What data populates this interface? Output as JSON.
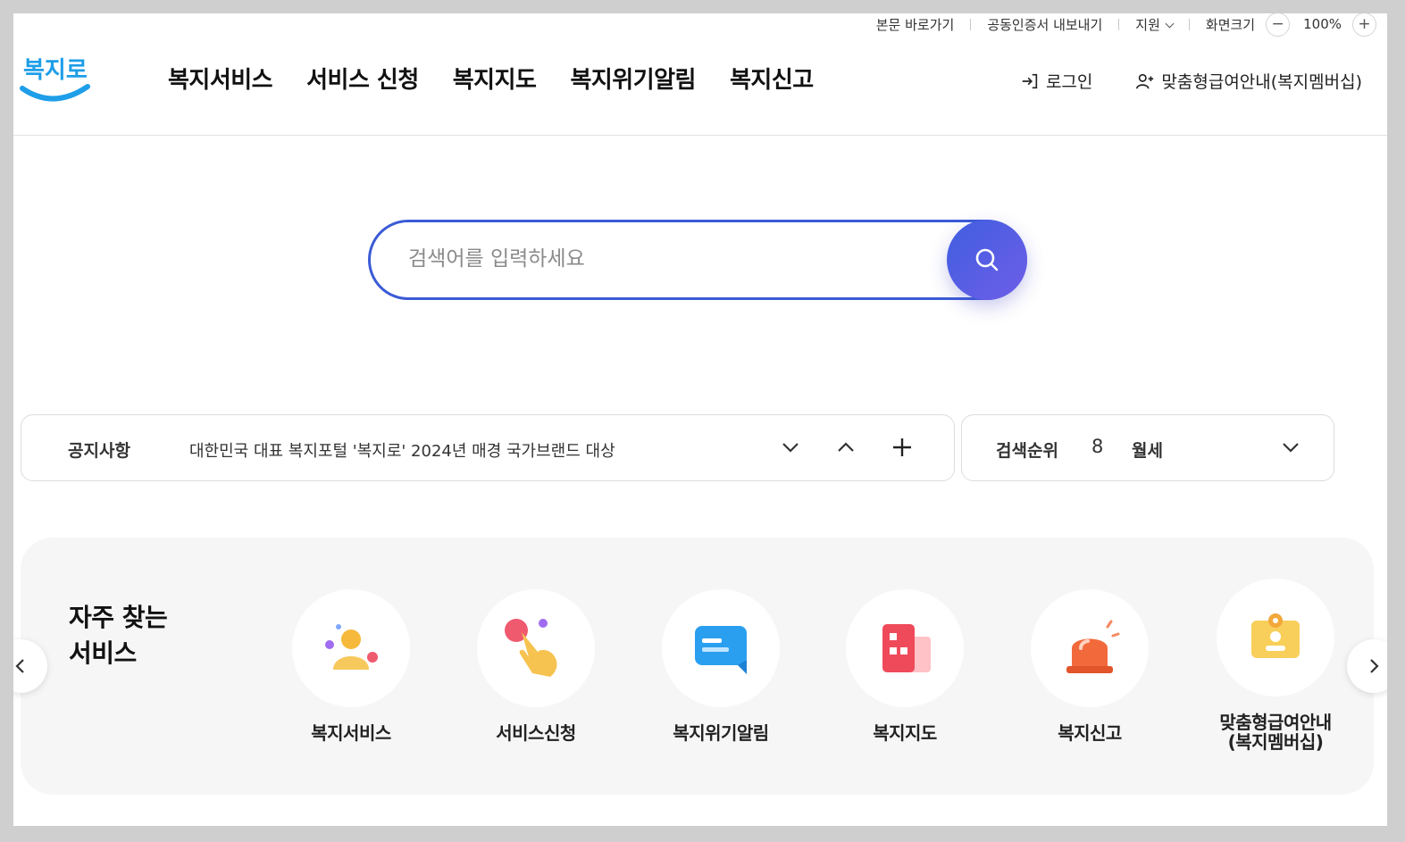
{
  "utility": {
    "skip_link": "본문 바로가기",
    "cert_export": "공동인증서 내보내기",
    "support": "지원",
    "screen_size": "화면크기",
    "zoom_out": "−",
    "zoom_value": "100%",
    "zoom_in": "+"
  },
  "logo_text": "복지로",
  "gnb": [
    "복지서비스",
    "서비스 신청",
    "복지지도",
    "복지위기알림",
    "복지신고"
  ],
  "header_right": {
    "login": "로그인",
    "membership": "맞춤형급여안내(복지멤버십)"
  },
  "search": {
    "placeholder": "검색어를 입력하세요",
    "value": ""
  },
  "notice": {
    "title": "공지사항",
    "text": "대한민국 대표 복지포털 '복지로' 2024년 매경 국가브랜드 대상"
  },
  "ranking": {
    "title": "검색순위",
    "rank": "8",
    "keyword": "월세"
  },
  "services": {
    "title": "자주 찾는\n서비스",
    "items": [
      {
        "label": "복지서비스",
        "icon": "person-icon"
      },
      {
        "label": "서비스신청",
        "icon": "hand-pointer-icon"
      },
      {
        "label": "복지위기알림",
        "icon": "message-icon"
      },
      {
        "label": "복지지도",
        "icon": "building-map-icon"
      },
      {
        "label": "복지신고",
        "icon": "siren-icon"
      },
      {
        "label": "맞춤형급여안내\n(복지멤버십)",
        "icon": "id-badge-icon"
      }
    ]
  },
  "colors": {
    "accent": "#3b5bd6",
    "search_button": "#5a5fe4",
    "logo_blue": "#1e9ee8"
  }
}
